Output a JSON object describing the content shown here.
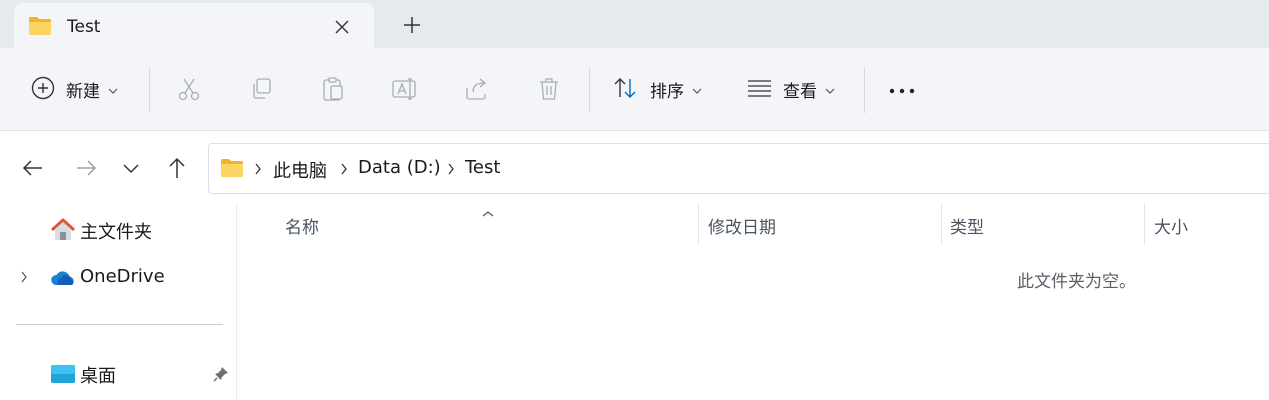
{
  "tab": {
    "title": "Test",
    "close": "close-tab",
    "new_tab": "new-tab"
  },
  "command_bar": {
    "new_label": "新建",
    "sort_label": "排序",
    "view_label": "查看",
    "more": "···"
  },
  "address": {
    "crumbs": [
      "此电脑",
      "Data (D:)",
      "Test"
    ]
  },
  "sidebar": {
    "items": [
      {
        "label": "主文件夹",
        "icon": "home-icon"
      },
      {
        "label": "OneDrive",
        "icon": "cloud-icon"
      },
      {
        "label": "桌面",
        "icon": "desktop-icon"
      }
    ]
  },
  "columns": [
    "名称",
    "修改日期",
    "类型",
    "大小"
  ],
  "empty_message": "此文件夹为空。",
  "colors": {
    "accent": "#0067c0",
    "folder": "#f7c544",
    "tabbar": "#e6e9ee",
    "toolbar": "#f3f5f8"
  }
}
